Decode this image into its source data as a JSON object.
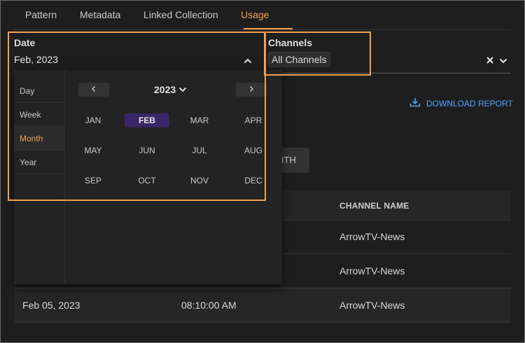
{
  "tabs": [
    {
      "label": "Pattern",
      "active": false
    },
    {
      "label": "Metadata",
      "active": false
    },
    {
      "label": "Linked Collection",
      "active": false
    },
    {
      "label": "Usage",
      "active": true
    }
  ],
  "date_field": {
    "label": "Date",
    "value": "Feb, 2023"
  },
  "channels_field": {
    "label": "Channels",
    "selected": "All Channels"
  },
  "picker": {
    "granularity": [
      "Day",
      "Week",
      "Month",
      "Year"
    ],
    "active_granularity": "Month",
    "prev_icon": "chevron-left",
    "next_icon": "chevron-right",
    "year": "2023",
    "months": [
      "JAN",
      "FEB",
      "MAR",
      "APR",
      "MAY",
      "JUN",
      "JUL",
      "AUG",
      "SEP",
      "OCT",
      "NOV",
      "DEC"
    ],
    "selected_month": "FEB"
  },
  "download": {
    "label": "DOWNLOAD REPORT"
  },
  "toggle": {
    "partial_label": "NTH"
  },
  "table": {
    "headers": {
      "channel_name": "CHANNEL NAME"
    },
    "rows": [
      {
        "date": "",
        "time": "",
        "channel": "ArrowTV-News"
      },
      {
        "date": "",
        "time": "",
        "channel": "ArrowTV-News"
      },
      {
        "date": "Feb 05, 2023",
        "time": "08:10:00 AM",
        "channel": "ArrowTV-News"
      }
    ]
  },
  "colors": {
    "accent": "#f0a050",
    "link": "#4da3ff",
    "selected_month_bg": "#3a2666",
    "background": "#1e1e1e"
  }
}
